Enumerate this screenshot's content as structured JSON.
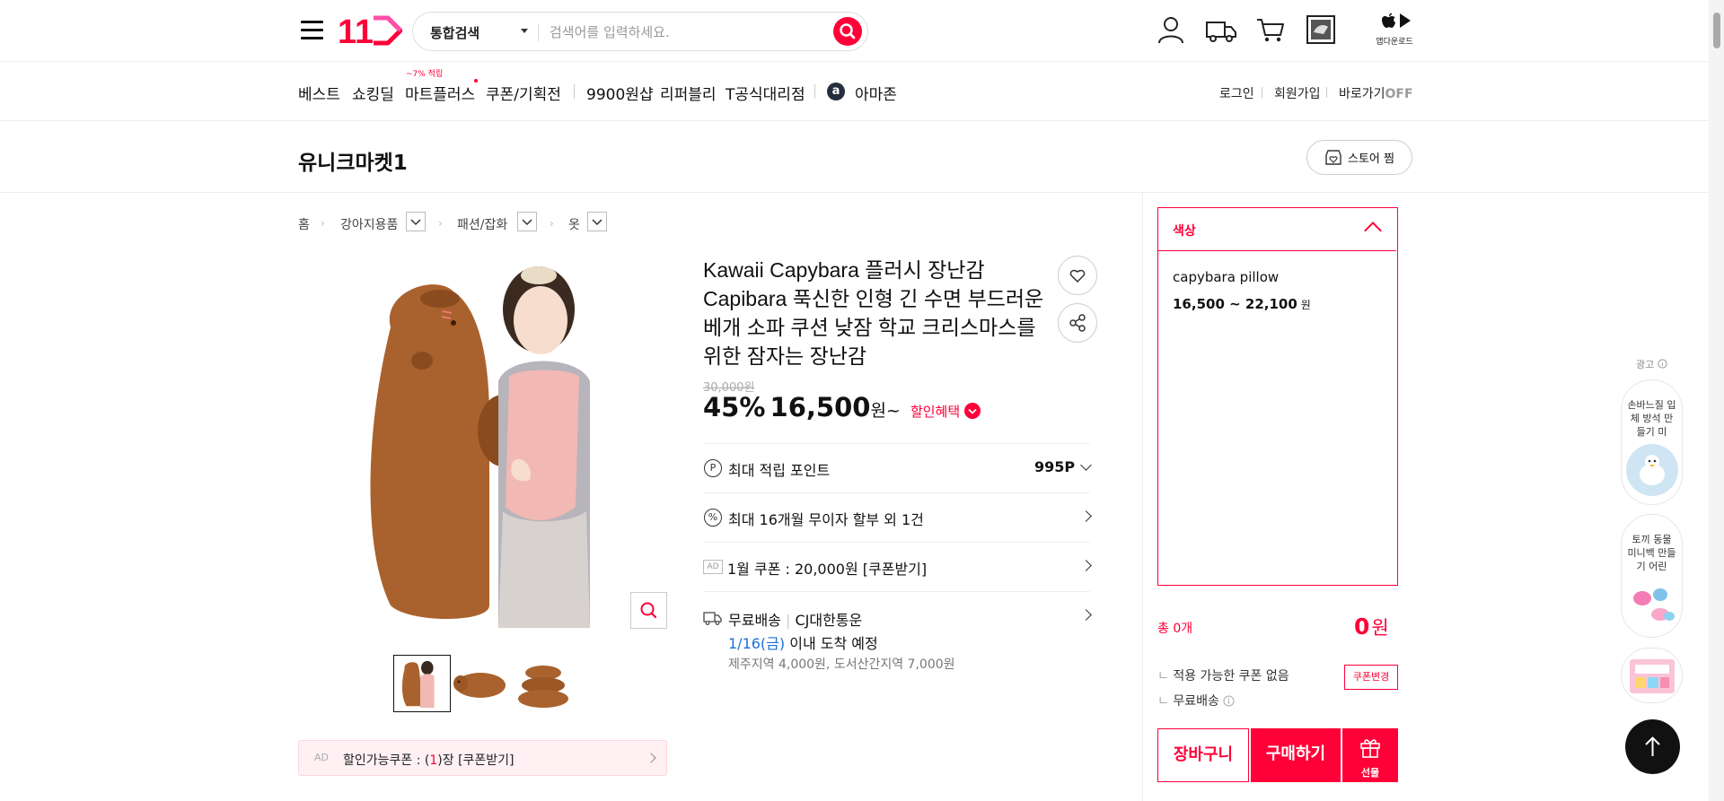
{
  "header": {
    "logo_text": "11",
    "search_category": "통합검색",
    "search_placeholder": "검색어를 입력하세요.",
    "app_download": "앱다운로드"
  },
  "nav": {
    "items": [
      "베스트",
      "쇼킹딜",
      "마트플러스",
      "쿠폰/기획전",
      "9900원샵",
      "리퍼블리",
      "T공식대리점",
      "아마존"
    ],
    "mart_badge": "~7% 적립",
    "amazon_icon": "a",
    "login": "로그인",
    "signup": "회원가입",
    "shortcut": "바로가기",
    "shortcut_state": "OFF"
  },
  "store": {
    "name": "유니크마켓1",
    "follow_label": "스토어 찜"
  },
  "breadcrumb": [
    "홈",
    "강아지용품",
    "패션/잡화",
    "옷"
  ],
  "product": {
    "title": "Kawaii Capybara 플러시 장난감 Capibara 푹신한 인형 긴 수면 부드러운 베개 소파 쿠션 낮잠 학교 크리스마스를 위한 잠자는 장난감",
    "original_price": "30,000원",
    "discount_rate": "45%",
    "sale_price": "16,500",
    "price_unit": "원~",
    "discount_benefit": "할인혜택",
    "points_label": "최대 적립 포인트",
    "points_value": "995P",
    "installment_label": "최대 16개월 무이자 할부 외 1건",
    "coupon_ad_badge": "AD",
    "coupon_label": "1월 쿠폰 : 20,000원 [쿠폰받기]",
    "delivery_label": "무료배송",
    "delivery_carrier": "CJ대한통운",
    "arrival_date": "1/16(금)",
    "arrival_text": "이내 도착 예정",
    "delivery_extra": "제주지역 4,000원, 도서산간지역 7,000원",
    "bottom_ad_badge": "AD",
    "bottom_coupon_prefix": "할인가능쿠폰 : (",
    "bottom_coupon_count": "1",
    "bottom_coupon_suffix": ")장 [쿠폰받기]"
  },
  "options": {
    "title": "색상",
    "item_name": "capybara pillow",
    "item_price": "16,500 ~ 22,100",
    "item_price_unit": "원"
  },
  "order": {
    "total_label": "총 0개",
    "total_value": "0",
    "total_unit": "원",
    "coupon_line": "적용 가능한 쿠폰 없음",
    "coupon_change": "쿠폰변경",
    "shipping_line": "무료배송",
    "cart_button": "장바구니",
    "buy_button": "구매하기",
    "gift_button": "선물"
  },
  "ad_rail": {
    "label": "광고",
    "cards": [
      {
        "text": "손바느질 입체 방석 만들기 미"
      },
      {
        "text": "토끼 동물 미니백 만들기 어린"
      }
    ]
  },
  "colors": {
    "accent": "#ff0038",
    "link_blue": "#1e6fd9"
  }
}
